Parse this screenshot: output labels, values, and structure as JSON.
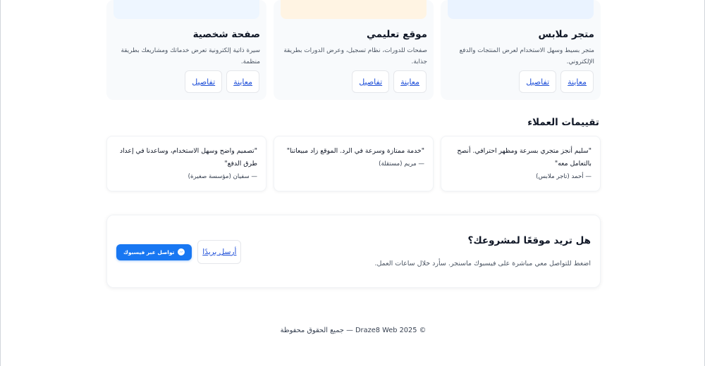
{
  "projects": [
    {
      "title": "متجر ملابس",
      "description": "متجر بسيط وسهل الاستخدام لعرض المنتجات والدفع الإلكتروني.",
      "preview_label": "معاينة",
      "details_label": "تفاصيل",
      "thumb_color": "#eaf3ff"
    },
    {
      "title": "موقع تعليمي",
      "description": "صفحات للدورات، نظام تسجيل، وعرض الدورات بطريقة جذابة.",
      "preview_label": "معاينة",
      "details_label": "تفاصيل",
      "thumb_color": "#fff4e3"
    },
    {
      "title": "صفحة شخصية",
      "description": "سيرة ذاتية إلكترونية تعرض خدماتك ومشاريعك بطريقة منظمة.",
      "preview_label": "معاينة",
      "details_label": "تفاصيل",
      "thumb_color": "#eef6ff"
    }
  ],
  "reviews": {
    "title": "تقييمات العملاء",
    "items": [
      {
        "quote": "\"سليم أنجز متجري بسرعة ومظهر احترافي. أنصح بالتعامل معه\"",
        "author": "— أحمد (تاجر ملابس)"
      },
      {
        "quote": "\"خدمة ممتازة وسرعة في الرد. الموقع زاد مبيعاتنا\"",
        "author": "— مريم (مستقلة)"
      },
      {
        "quote": "\"تصميم واضح وسهل الاستخدام، وساعدنا في إعداد طرق الدفع\"",
        "author": "— سفيان (مؤسسة صغيرة)"
      }
    ]
  },
  "cta": {
    "title": "هل تريد موقعًا لمشروعك؟",
    "text": "اضغط للتواصل معي مباشرة على فيسبوك ماسنجر. سأرد خلال ساعات العمل.",
    "messenger_label": "تواصل عبر فيسبوك",
    "email_label": "أرسل بريدًا",
    "messenger_color": "#1877f2"
  },
  "footer": {
    "text": "© 2025 Draze8 Web — جميع الحقوق محفوظة"
  }
}
